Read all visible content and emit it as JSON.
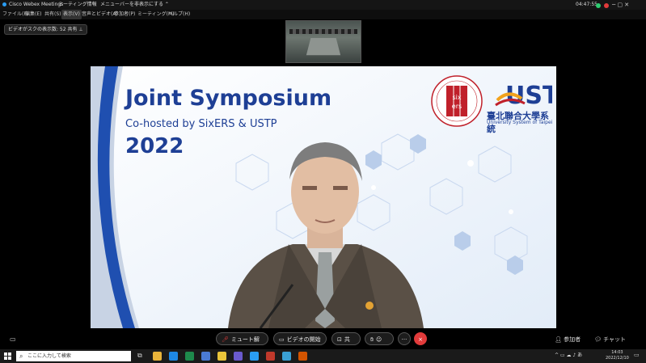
{
  "titlebar": {
    "app_name": "Cisco Webex Meetings",
    "meeting_info": "ミーティング情報",
    "menu_bar_toggle": "メニューバーを非表示にする ⌃",
    "clock": "04:47:55"
  },
  "menu": {
    "items": [
      {
        "label": "ファイル(F)"
      },
      {
        "label": "編集(E)"
      },
      {
        "label": "共有(S)"
      },
      {
        "label": "表示(V)"
      },
      {
        "label": "音声とビデオ(A)"
      },
      {
        "label": "参加者(P)"
      },
      {
        "label": "ミーティング(M)"
      },
      {
        "label": "ヘルプ(H)"
      }
    ]
  },
  "layout_pill": "ビデオがスクの表示数: 52 共有 ⊥",
  "slide": {
    "headline": "Joint Symposium",
    "subline": "Co-hosted by SixERS & USTP",
    "year": "2022",
    "logo_left_text": "six ers",
    "logo_right_mark": "UST",
    "logo_right_name": "臺北聯合大學系統",
    "logo_right_sub": "University System of Taipei"
  },
  "controls": {
    "mute_label": "ミュート解除",
    "video_label": "ビデオの開始",
    "share_label": "共有",
    "more_label": "···",
    "end_label": "×",
    "participants_label": "参加者",
    "chat_label": "チャット"
  },
  "taskbar": {
    "search_placeholder": "ここに入力して検索",
    "time": "14:03",
    "date": "2022/12/10",
    "tray": "^ ▭ ☁ ♪ あ"
  },
  "colors": {
    "brand_blue": "#1e3f95",
    "end_red": "#e23b3b",
    "webex_blue": "#2a9df4"
  }
}
